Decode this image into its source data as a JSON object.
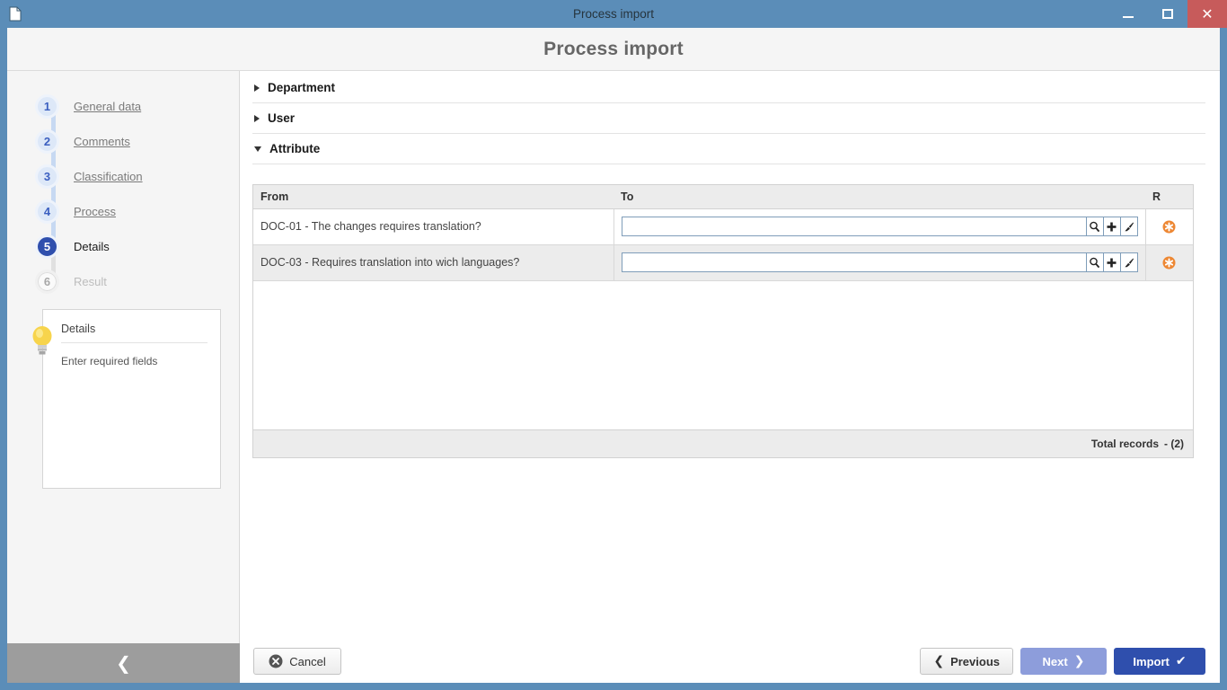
{
  "window": {
    "title": "Process import",
    "doc_icon": "document-icon",
    "minimize_label": "Minimize",
    "maximize_label": "Maximize",
    "close_label": "Close"
  },
  "header": {
    "title": "Process import"
  },
  "sidebar": {
    "steps": [
      {
        "number": "1",
        "label": "General data",
        "state": "done"
      },
      {
        "number": "2",
        "label": "Comments",
        "state": "done"
      },
      {
        "number": "3",
        "label": "Classification",
        "state": "done"
      },
      {
        "number": "4",
        "label": "Process",
        "state": "done"
      },
      {
        "number": "5",
        "label": "Details",
        "state": "current"
      },
      {
        "number": "6",
        "label": "Result",
        "state": "disabled"
      }
    ],
    "hint": {
      "icon": "lightbulb-icon",
      "title": "Details",
      "text": "Enter required fields"
    },
    "collapse_icon": "chevron-left-icon"
  },
  "main": {
    "sections": [
      {
        "label": "Department",
        "expanded": false
      },
      {
        "label": "User",
        "expanded": false
      },
      {
        "label": "Attribute",
        "expanded": true
      }
    ],
    "table": {
      "columns": [
        "From",
        "To",
        "R"
      ],
      "rows": [
        {
          "from": "DOC-01 - The changes requires translation?",
          "to_value": "",
          "to_placeholder": "",
          "required_icon": "required-asterisk-icon",
          "actions": [
            "search-icon",
            "plus-icon",
            "brush-icon"
          ]
        },
        {
          "from": "DOC-03 - Requires translation into wich languages?",
          "to_value": "",
          "to_placeholder": "",
          "required_icon": "required-asterisk-icon",
          "actions": [
            "search-icon",
            "plus-icon",
            "brush-icon"
          ]
        }
      ],
      "footer": {
        "total_label": "Total records",
        "total_count": "- (2)"
      }
    }
  },
  "footer": {
    "cancel_label": "Cancel",
    "previous_label": "Previous",
    "next_label": "Next",
    "import_label": "Import",
    "cancel_icon": "circle-x-icon",
    "previous_icon": "chevron-left-icon",
    "next_icon": "chevron-right-icon",
    "import_icon": "check-icon"
  },
  "colors": {
    "titlebar": "#5b8db8",
    "close_button": "#c75b5b",
    "accent_blue": "#2f4fad",
    "next_blue": "#8d9ddb",
    "required_orange": "#ed8733",
    "collapse_grey": "#9d9d9d"
  }
}
